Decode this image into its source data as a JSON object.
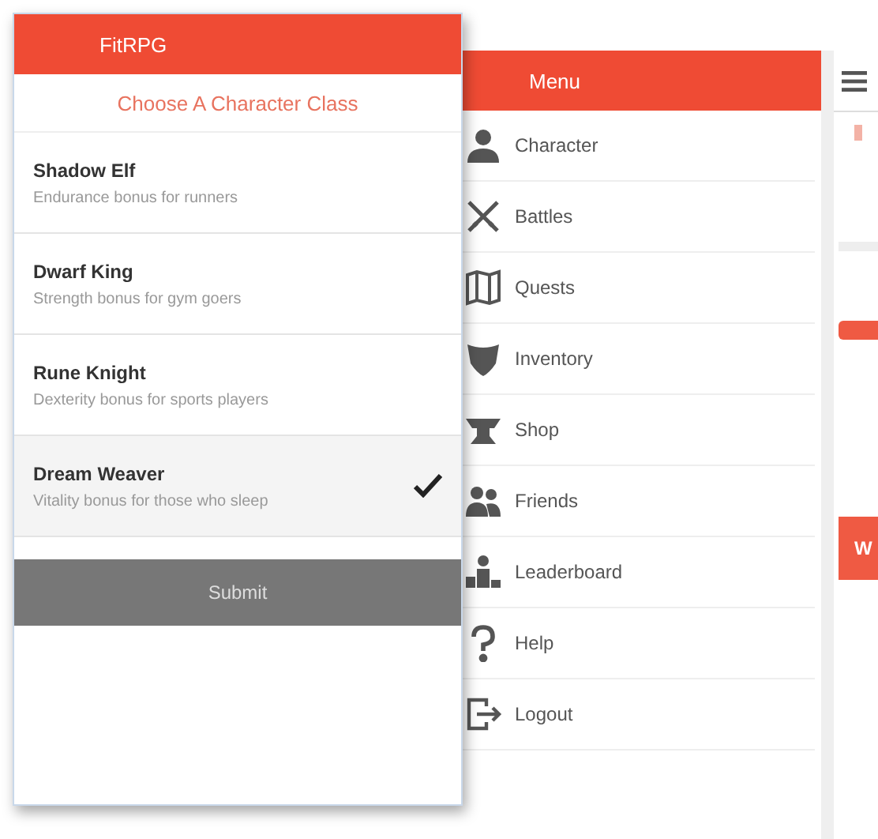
{
  "class_screen": {
    "title": "FitRPG",
    "heading": "Choose A Character Class",
    "classes": [
      {
        "name": "Shadow Elf",
        "description": "Endurance bonus for runners",
        "selected": false
      },
      {
        "name": "Dwarf King",
        "description": "Strength bonus for gym goers",
        "selected": false
      },
      {
        "name": "Rune Knight",
        "description": "Dexterity bonus for sports players",
        "selected": false
      },
      {
        "name": "Dream Weaver",
        "description": "Vitality bonus for those who sleep",
        "selected": true
      }
    ],
    "submit": "Submit"
  },
  "menu_screen": {
    "title": "Menu",
    "items": [
      {
        "label": "Character",
        "kind": "person"
      },
      {
        "label": "Battles",
        "kind": "swords"
      },
      {
        "label": "Quests",
        "kind": "map"
      },
      {
        "label": "Inventory",
        "kind": "shield"
      },
      {
        "label": "Shop",
        "kind": "anvil"
      },
      {
        "label": "Friends",
        "kind": "friends"
      },
      {
        "label": "Leaderboard",
        "kind": "podium"
      },
      {
        "label": "Help",
        "kind": "help"
      },
      {
        "label": "Logout",
        "kind": "logout"
      }
    ]
  },
  "main_screen": {
    "card_title": "W"
  }
}
